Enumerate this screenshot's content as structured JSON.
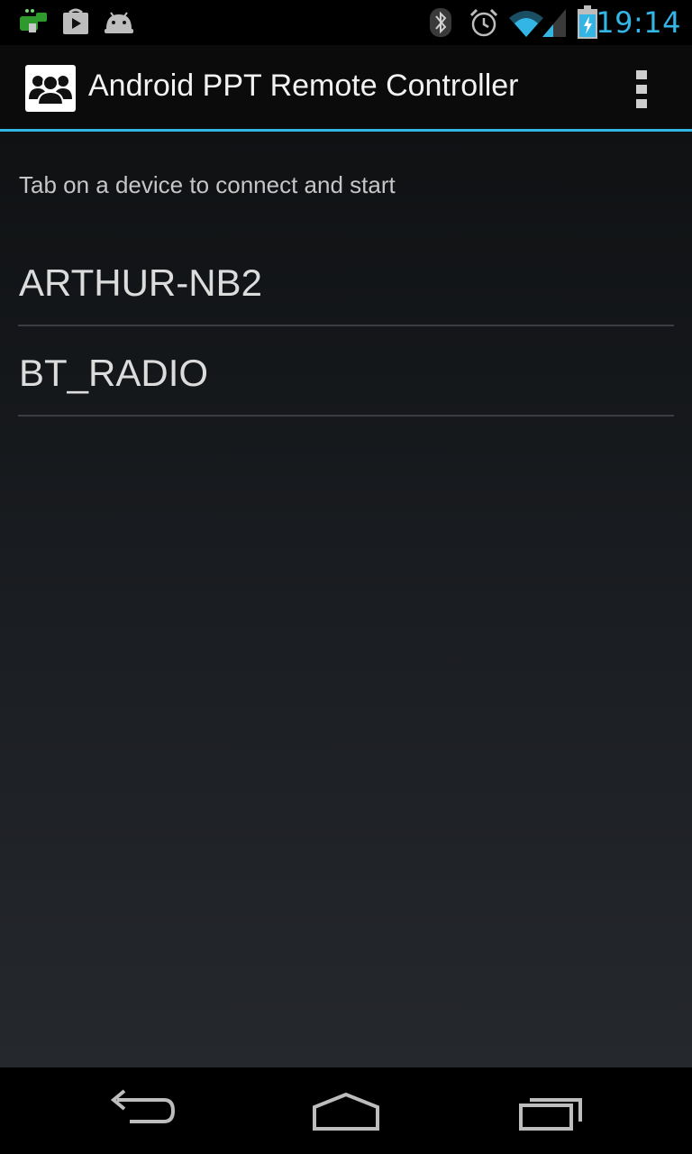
{
  "status_bar": {
    "time": "19:14",
    "time_color": "#33b5e5",
    "left_icons": [
      "app-notification-icon",
      "play-store-icon",
      "android-icon"
    ],
    "right_icons": [
      "bluetooth-icon",
      "alarm-icon",
      "wifi-icon",
      "signal-icon",
      "battery-charging-icon"
    ]
  },
  "action_bar": {
    "title": "Android PPT Remote Controller",
    "icon": "people-group-icon",
    "accent_color": "#33b5e5"
  },
  "content": {
    "hint": "Tab on a device to connect and start",
    "devices": [
      {
        "label": "ARTHUR-NB2"
      },
      {
        "label": "BT_RADIO"
      }
    ]
  },
  "nav_bar": {
    "buttons": [
      "back-icon",
      "home-icon",
      "recent-apps-icon"
    ]
  }
}
